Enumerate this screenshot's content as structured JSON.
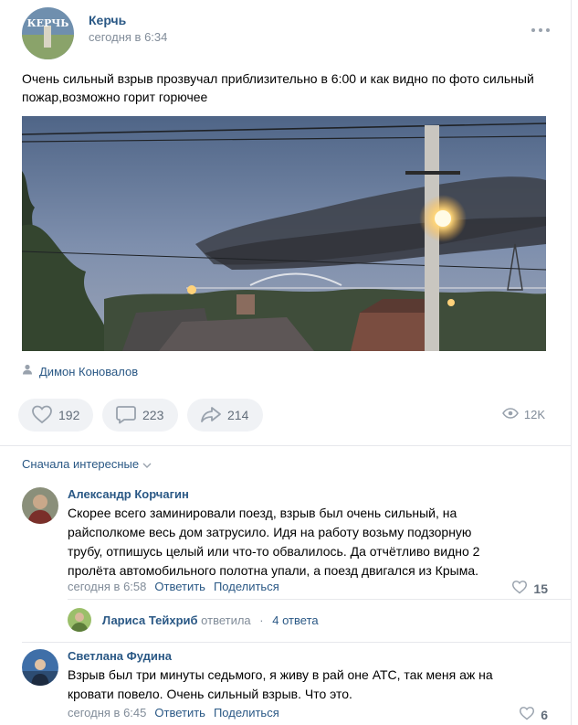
{
  "post": {
    "group_name": "Керчь",
    "avatar_text": "КЕРЧЬ",
    "time": "сегодня в 6:34",
    "text": "Очень сильный взрыв прозвучал приблизительно в 6:00 и как видно по фото сильный пожар,возможно горит горючее",
    "author": "Димон Коновалов",
    "likes": "192",
    "comments": "223",
    "shares": "214",
    "views": "12K"
  },
  "comments_section": {
    "sort_label": "Сначала интересные"
  },
  "comments": [
    {
      "name": "Александр Корчагин",
      "text": "Скорее всего заминировали поезд, взрыв был очень сильный, на райсполкоме весь дом затрусило. Идя на работу возьму подзорную трубу, отпишусь целый или что-то обвалилось. Да отчётливо видно 2 пролёта автомобильного полотна упали, а поезд двигался из Крыма.",
      "time": "сегодня в 6:58",
      "reply_label": "Ответить",
      "share_label": "Поделиться",
      "likes": "15"
    },
    {
      "name": "Светлана Фудина",
      "text": "Взрыв был три минуты седьмого, я живу в рай оне АТС, так меня аж на кровати повело. Очень сильный взрыв. Что это.",
      "time": "сегодня в 6:45",
      "reply_label": "Ответить",
      "share_label": "Поделиться",
      "likes": "6"
    }
  ],
  "reply_thread": {
    "name": "Лариса Тейхриб",
    "verb": "ответила",
    "separator": "·",
    "count": "4 ответа"
  },
  "colors": {
    "link": "#2a5885",
    "muted": "#818c99",
    "button_bg": "#f0f2f5"
  }
}
